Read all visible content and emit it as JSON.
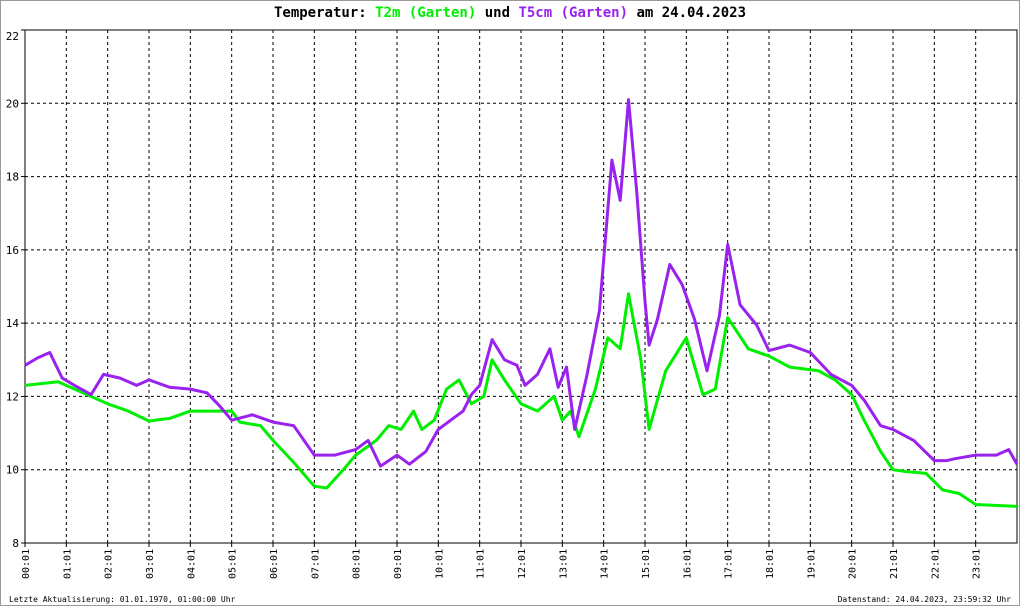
{
  "title": {
    "prefix": "Temperatur: ",
    "series1": "T2m (Garten)",
    "mid": " und ",
    "series2": "T5cm (Garten)",
    "suffix": " am 24.04.2023"
  },
  "footer": {
    "last_update": "Letzte Aktualisierung: 01.01.1970, 01:00:00 Uhr",
    "data_status": "Datenstand: 24.04.2023, 23:59:32 Uhr"
  },
  "chart_data": {
    "type": "line",
    "title": "Temperatur: T2m (Garten) und T5cm (Garten) am 24.04.2023",
    "xlabel": "",
    "ylabel": "",
    "xlim": [
      0,
      24
    ],
    "ylim": [
      8,
      22
    ],
    "grid": true,
    "y_ticks": [
      "8",
      "10",
      "12",
      "14",
      "16",
      "18",
      "20",
      "22"
    ],
    "x_ticks": [
      "00:01",
      "01:01",
      "02:01",
      "03:01",
      "04:01",
      "05:01",
      "06:01",
      "07:01",
      "08:01",
      "09:01",
      "10:01",
      "11:01",
      "12:01",
      "13:01",
      "14:01",
      "15:01",
      "16:01",
      "17:01",
      "18:01",
      "19:01",
      "20:01",
      "21:01",
      "22:01",
      "23:01"
    ],
    "series": [
      {
        "name": "T2m (Garten)",
        "color": "#00ee00",
        "x": [
          0,
          0.8,
          1.5,
          2,
          2.5,
          3,
          3.5,
          4,
          5,
          5.2,
          5.7,
          6,
          6.5,
          7,
          7.3,
          7.7,
          8,
          8.5,
          8.8,
          9.1,
          9.4,
          9.6,
          9.9,
          10.2,
          10.5,
          10.8,
          11.1,
          11.3,
          11.6,
          12,
          12.4,
          12.8,
          13,
          13.2,
          13.4,
          13.8,
          14.1,
          14.4,
          14.6,
          14.9,
          15.1,
          15.5,
          16,
          16.4,
          16.7,
          17,
          17.5,
          18,
          18.5,
          19.2,
          19.6,
          20,
          20.3,
          20.7,
          21,
          21.3,
          21.8,
          22.2,
          22.6,
          23,
          24
        ],
        "values": [
          12.3,
          12.4,
          12.05,
          11.8,
          11.6,
          11.33,
          11.4,
          11.6,
          11.6,
          11.3,
          11.2,
          10.8,
          10.2,
          9.55,
          9.5,
          10,
          10.4,
          10.8,
          11.2,
          11.1,
          11.6,
          11.1,
          11.35,
          12.2,
          12.45,
          11.8,
          12,
          13,
          12.45,
          11.8,
          11.6,
          12,
          11.35,
          11.6,
          10.9,
          12.2,
          13.6,
          13.3,
          14.8,
          13,
          11.1,
          12.7,
          13.6,
          12.05,
          12.2,
          14.15,
          13.3,
          13.1,
          12.8,
          12.7,
          12.45,
          12.05,
          11.35,
          10.5,
          10,
          9.95,
          9.9,
          9.45,
          9.35,
          9.05,
          9.0
        ]
      },
      {
        "name": "T5cm (Garten)",
        "color": "#9a22ee",
        "x": [
          0,
          0.3,
          0.6,
          0.9,
          1.2,
          1.6,
          1.9,
          2.3,
          2.7,
          3,
          3.5,
          4,
          4.4,
          4.7,
          5,
          5.5,
          6,
          6.5,
          7,
          7.5,
          8,
          8.3,
          8.6,
          9,
          9.3,
          9.7,
          10,
          10.3,
          10.6,
          10.8,
          11,
          11.3,
          11.6,
          11.9,
          12.1,
          12.4,
          12.7,
          12.9,
          13.1,
          13.3,
          13.6,
          13.9,
          14.2,
          14.4,
          14.6,
          14.8,
          15,
          15.1,
          15.3,
          15.6,
          15.9,
          16.2,
          16.5,
          16.8,
          17,
          17.3,
          17.7,
          18,
          18.5,
          19,
          19.5,
          20,
          20.3,
          20.7,
          21,
          21.5,
          22,
          22.3,
          22.5,
          23,
          23.5,
          23.8,
          24
        ],
        "values": [
          12.85,
          13.05,
          13.2,
          12.5,
          12.3,
          12.05,
          12.6,
          12.5,
          12.3,
          12.45,
          12.25,
          12.2,
          12.1,
          11.75,
          11.35,
          11.5,
          11.3,
          11.2,
          10.4,
          10.4,
          10.55,
          10.8,
          10.1,
          10.4,
          10.15,
          10.5,
          11.1,
          11.35,
          11.6,
          12.05,
          12.3,
          13.55,
          13,
          12.85,
          12.3,
          12.6,
          13.3,
          12.25,
          12.8,
          11.1,
          12.6,
          14.35,
          18.45,
          17.35,
          20.1,
          17.6,
          14.6,
          13.4,
          14.1,
          15.6,
          15.05,
          14.1,
          12.7,
          14.2,
          16.15,
          14.5,
          13.95,
          13.25,
          13.4,
          13.2,
          12.6,
          12.3,
          11.9,
          11.2,
          11.1,
          10.8,
          10.25,
          10.25,
          10.3,
          10.4,
          10.4,
          10.55,
          10.15
        ]
      }
    ]
  }
}
